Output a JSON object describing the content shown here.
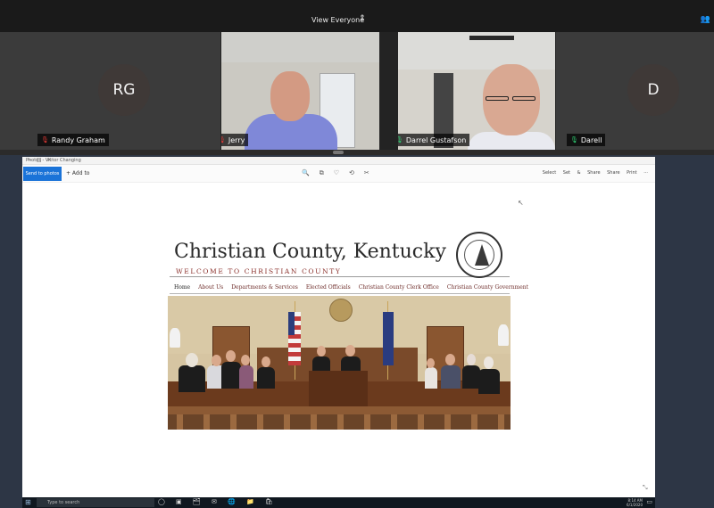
{
  "zoom": {
    "view_label": "View Everyone",
    "view_chevron": "⇕",
    "participants_icon": "people-icon",
    "participants_glyph": "👥",
    "participants_count": "3"
  },
  "gallery": [
    {
      "initials": "RG",
      "name": "Randy Graham",
      "muted": true
    },
    {
      "initials": "",
      "name": "Jerry",
      "muted": true
    },
    {
      "initials": "",
      "name": "Darrel Gustafson",
      "muted": false
    },
    {
      "initials": "D",
      "name": "Darell",
      "muted": false
    }
  ],
  "mic_glyph": "🎙",
  "app_window": {
    "title": "Photos - Victor Changing",
    "window_controls": "—□✕",
    "send_button": "Send to photos",
    "add_label": "+ Add to",
    "toolbar_icons": "🔍⧉♡⟲✂",
    "toolbar_right": "Select  Set & Share  Share  Print  ···"
  },
  "website": {
    "title": "Christian County, Kentucky",
    "subtitle": "WELCOME TO CHRISTIAN COUNTY",
    "nav": [
      "Home",
      "About Us",
      "Departments & Services",
      "Elected Officials",
      "Christian County Clerk Office",
      "Christian County Government"
    ]
  },
  "taskbar": {
    "start_glyph": "⊞",
    "search_placeholder": "Type to search",
    "icons": "◯ ▣ 🗂 ✉ 🌐 📁 🛍",
    "time": "8:14 AM",
    "date": "6/1/2020",
    "notif_glyph": "▭"
  },
  "colors": {
    "muted_mic": "#e53935",
    "live_mic": "#2ecc71",
    "send_button": "#1a73d8",
    "subtitle_red": "#8a2f2a"
  }
}
